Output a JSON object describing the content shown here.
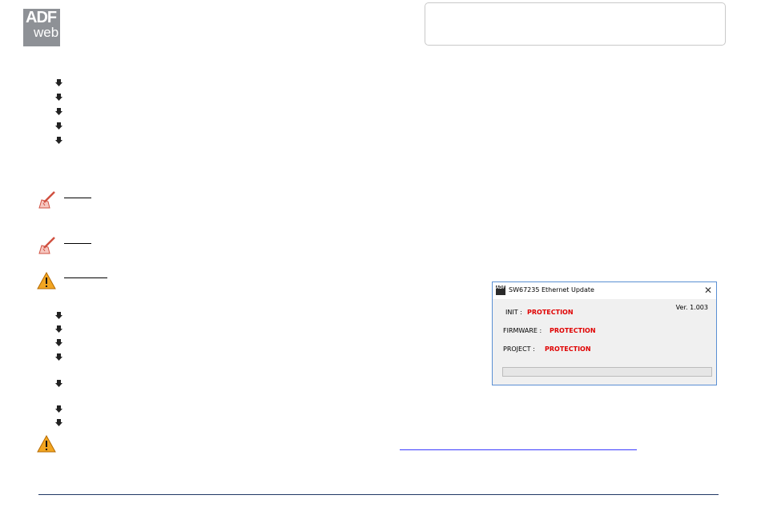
{
  "logo": {
    "line1": "ADF",
    "line2": "web"
  },
  "dialog": {
    "title": "SW67235 Ethernet Update",
    "close_symbol": "✕",
    "version": "Ver. 1.003",
    "init_label": "INIT :",
    "init_value": "PROTECTION",
    "firmware_label": "FIRMWARE :",
    "firmware_value": "PROTECTION",
    "project_label": "PROJECT :",
    "project_value": "PROTECTION",
    "progress": 0,
    "icon_text": "ADF"
  },
  "colors": {
    "logo_bg": "#8e9196",
    "status_red": "#e00000",
    "dialog_border": "#5a8fd3",
    "footer_line": "#1f3864",
    "link": "#3a3aff"
  },
  "icons": {
    "bullet": "arrow-bullet-icon",
    "note": "note-pencil-icon",
    "warning": "warning-triangle-icon"
  }
}
